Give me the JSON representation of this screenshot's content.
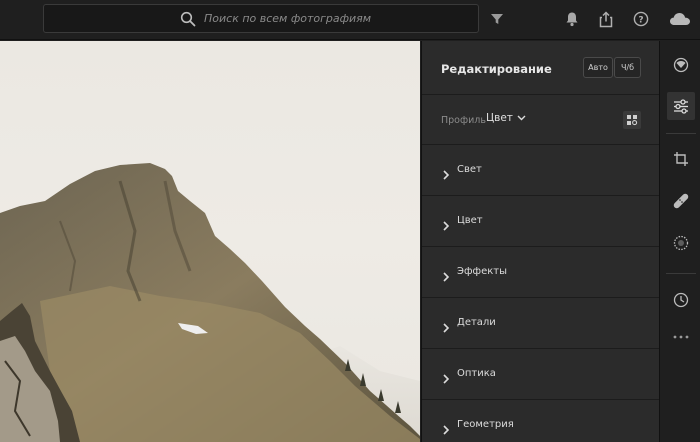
{
  "search": {
    "placeholder": "Поиск по всем фотографиям"
  },
  "panel": {
    "title": "Редактирование",
    "auto_label": "Авто",
    "bw_label": "Ч/б",
    "profile_label": "Профиль",
    "profile_value": "Цвет",
    "sections": [
      {
        "label": "Свет"
      },
      {
        "label": "Цвет"
      },
      {
        "label": "Эффекты"
      },
      {
        "label": "Детали"
      },
      {
        "label": "Оптика"
      },
      {
        "label": "Геометрия"
      }
    ]
  },
  "icons": {
    "search": "search-icon",
    "filter": "filter-icon",
    "bell": "bell-icon",
    "share": "share-icon",
    "help": "help-icon",
    "cloud": "cloud-icon",
    "tools": [
      "presets-icon",
      "edit-sliders-icon",
      "crop-icon",
      "healing-icon",
      "masking-icon",
      "history-icon",
      "more-icon"
    ]
  },
  "colors": {
    "panel_bg": "#2b2b2b",
    "app_bg": "#1f1f1f",
    "text": "#dcdcdc"
  }
}
